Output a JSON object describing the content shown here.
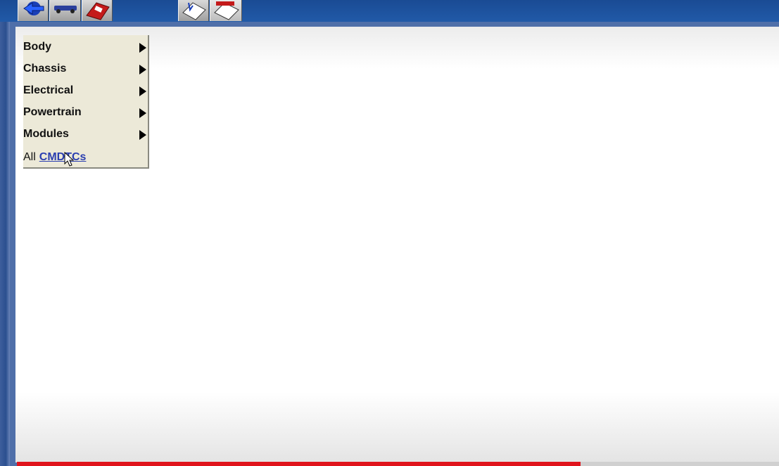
{
  "menu": {
    "items": [
      {
        "label": "Body"
      },
      {
        "label": "Chassis"
      },
      {
        "label": "Electrical"
      },
      {
        "label": "Powertrain"
      },
      {
        "label": "Modules"
      }
    ],
    "all_prefix": "All",
    "all_link": "CMDTCs"
  },
  "toolbar": {
    "icons": [
      "back-arrow-icon",
      "vehicle-icon",
      "diagnostic-tool-icon",
      "tool-info-icon",
      "dtc-icon"
    ]
  },
  "progress": {
    "fraction": 0.74,
    "color": "#e0141c"
  },
  "colors": {
    "frame": "#1f4f97",
    "menu_bg": "#ece9d8",
    "link": "#2b3fb0"
  }
}
